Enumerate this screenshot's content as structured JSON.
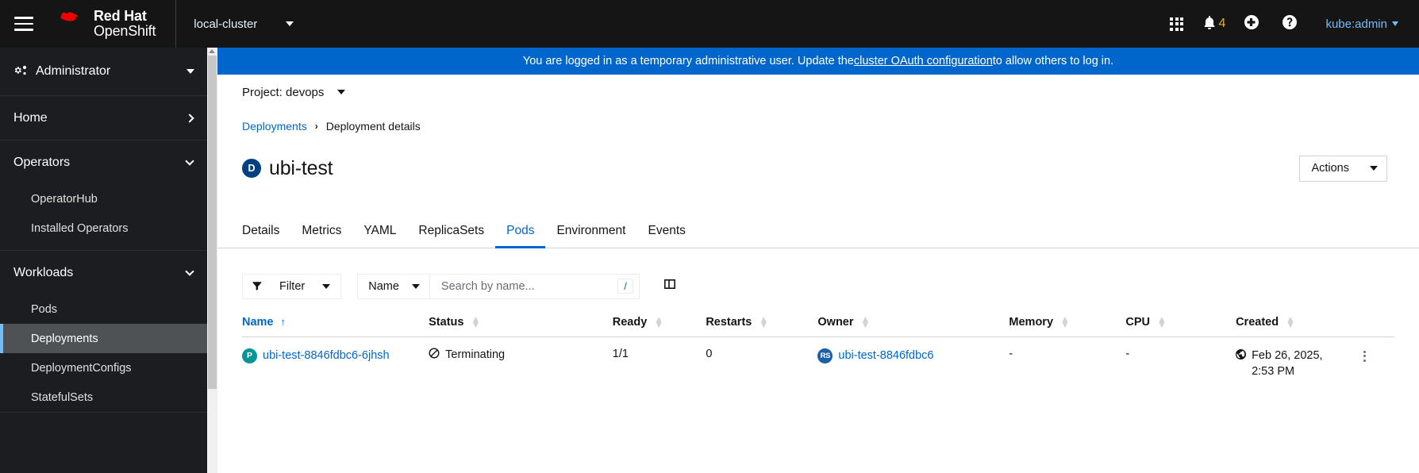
{
  "masthead": {
    "brand_line1": "Red Hat",
    "brand_line2": "OpenShift",
    "cluster": "local-cluster",
    "notification_count": "4",
    "user": "kube:admin"
  },
  "sidebar": {
    "perspective": "Administrator",
    "groups": [
      {
        "label": "Home",
        "expanded": false,
        "items": []
      },
      {
        "label": "Operators",
        "expanded": true,
        "items": [
          "OperatorHub",
          "Installed Operators"
        ]
      },
      {
        "label": "Workloads",
        "expanded": true,
        "items": [
          "Pods",
          "Deployments",
          "DeploymentConfigs",
          "StatefulSets"
        ]
      }
    ],
    "active_item": "Deployments"
  },
  "banner": {
    "text_before": "You are logged in as a temporary administrative user. Update the ",
    "link": "cluster OAuth configuration",
    "text_after": " to allow others to log in."
  },
  "project": {
    "label": "Project: devops"
  },
  "breadcrumb": {
    "parent": "Deployments",
    "separator": "›",
    "current": "Deployment details"
  },
  "page": {
    "badge": "D",
    "title": "ubi-test",
    "actions_label": "Actions"
  },
  "tabs": [
    {
      "label": "Details",
      "active": false
    },
    {
      "label": "Metrics",
      "active": false
    },
    {
      "label": "YAML",
      "active": false
    },
    {
      "label": "ReplicaSets",
      "active": false
    },
    {
      "label": "Pods",
      "active": true
    },
    {
      "label": "Environment",
      "active": false
    },
    {
      "label": "Events",
      "active": false
    }
  ],
  "toolbar": {
    "filter_label": "Filter",
    "attribute_label": "Name",
    "search_placeholder": "Search by name...",
    "search_value": "",
    "shortcut_key": "/"
  },
  "table": {
    "columns": [
      {
        "label": "Name",
        "sort": "asc"
      },
      {
        "label": "Status",
        "sort": "none"
      },
      {
        "label": "Ready",
        "sort": "none"
      },
      {
        "label": "Restarts",
        "sort": "none"
      },
      {
        "label": "Owner",
        "sort": "none"
      },
      {
        "label": "Memory",
        "sort": "none"
      },
      {
        "label": "CPU",
        "sort": "none"
      },
      {
        "label": "Created",
        "sort": "none"
      }
    ],
    "rows": [
      {
        "name_badge": "P",
        "name": "ubi-test-8846fdbc6-6jhsh",
        "status": "Terminating",
        "ready": "1/1",
        "restarts": "0",
        "owner_badge": "RS",
        "owner": "ubi-test-8846fdbc6",
        "memory": "-",
        "cpu": "-",
        "created_line1": "Feb 26, 2025,",
        "created_line2": "2:53 PM"
      }
    ]
  },
  "colors": {
    "brand_red": "#ee0000",
    "accent_blue": "#0066cc",
    "banner_blue": "#0066cc",
    "badge_deployment": "#004080",
    "badge_pod": "#009596",
    "badge_replicaset": "#1b5faa",
    "notification_amber": "#f0ab00"
  }
}
